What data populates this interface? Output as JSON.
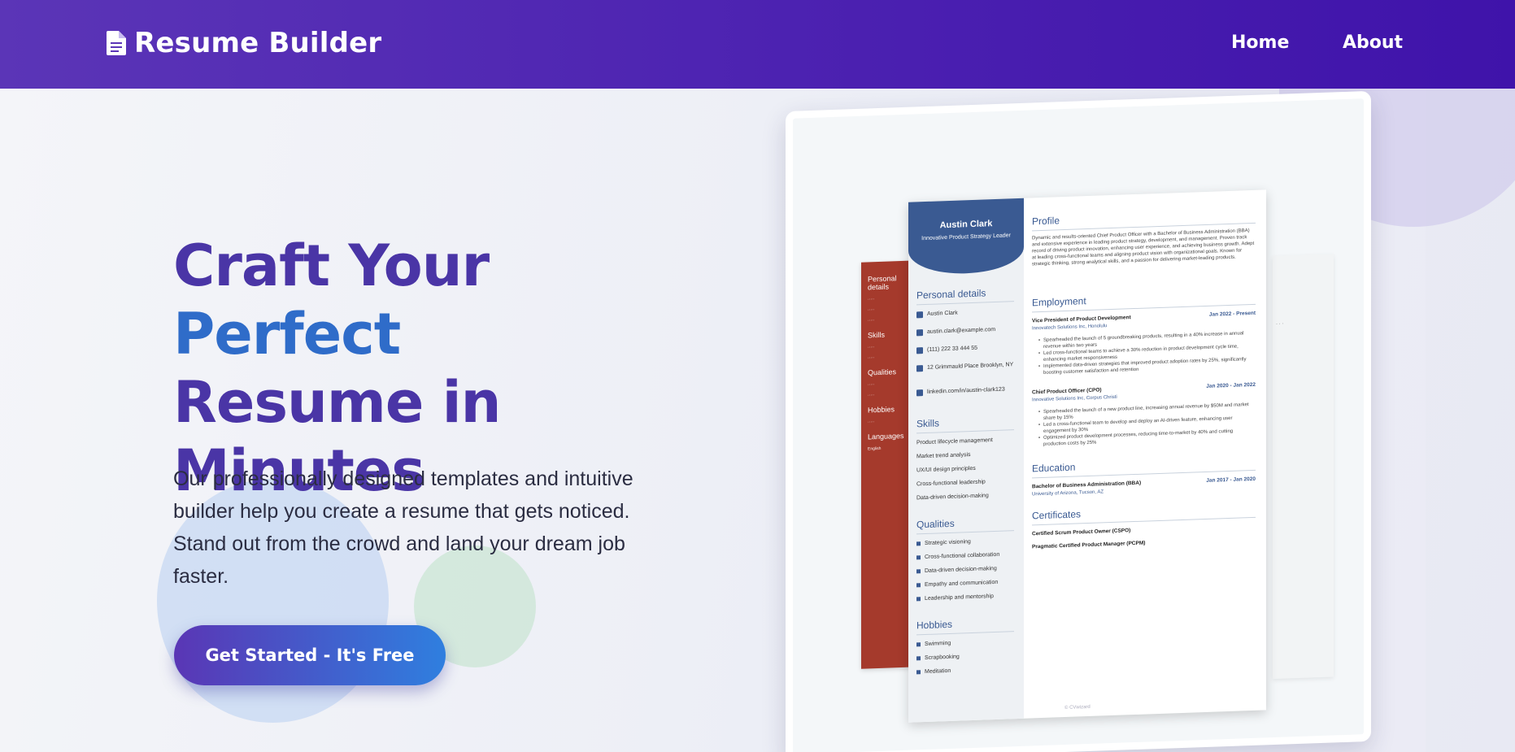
{
  "navbar": {
    "brand": "Resume Builder",
    "links": {
      "home": "Home",
      "about": "About"
    }
  },
  "hero": {
    "headline_dark_1": "Craft Your ",
    "headline_blue": "Perfect",
    "headline_dark_2": "Resume in",
    "headline_dark_3": "Minutes",
    "subtext": "Our professionally designed templates and intuitive builder help you create a resume that gets noticed. Stand out from the crowd and land your dream job faster.",
    "cta": "Get Started - It's Free"
  },
  "resume_preview": {
    "name": "Austin Clark",
    "tagline": "Innovative Product Strategy Leader",
    "personal_title": "Personal details",
    "personal": [
      "Austin Clark",
      "austin.clark@example.com",
      "(111) 222 33 444 55",
      "12 Grimmauld Place Brooklyn, NY",
      "linkedin.com/in/austin-clark123"
    ],
    "skills_title": "Skills",
    "skills": [
      "Product lifecycle management",
      "Market trend analysis",
      "UX/UI design principles",
      "Cross-functional leadership",
      "Data-driven decision-making"
    ],
    "qualities_title": "Qualities",
    "qualities": [
      "Strategic visioning",
      "Cross-functional collaboration",
      "Data-driven decision-making",
      "Empathy and communication",
      "Leadership and mentorship"
    ],
    "hobbies_title": "Hobbies",
    "hobbies": [
      "Swimming",
      "Scrapbooking",
      "Meditation"
    ],
    "profile_title": "Profile",
    "profile_text": "Dynamic and results-oriented Chief Product Officer with a Bachelor of Business Administration (BBA) and extensive experience in leading product strategy, development, and management. Proven track record of driving product innovation, enhancing user experience, and achieving business growth. Adept at leading cross-functional teams and aligning product vision with organizational goals. Known for strategic thinking, strong analytical skills, and a passion for delivering market-leading products.",
    "employment_title": "Employment",
    "jobs": [
      {
        "title": "Vice President of Product Development",
        "date": "Jan 2022 - Present",
        "company": "Innovatech Solutions Inc, Honolulu",
        "bullets": [
          "Spearheaded the launch of 5 groundbreaking products, resulting in a 40% increase in annual revenue within two years",
          "Led cross-functional teams to achieve a 30% reduction in product development cycle time, enhancing market responsiveness",
          "Implemented data-driven strategies that improved product adoption rates by 25%, significantly boosting customer satisfaction and retention"
        ]
      },
      {
        "title": "Chief Product Officer (CPO)",
        "date": "Jan 2020 - Jan 2022",
        "company": "Innovative Solutions Inc, Corpus Christi",
        "bullets": [
          "Spearheaded the launch of a new product line, increasing annual revenue by $50M and market share by 15%",
          "Led a cross-functional team to develop and deploy an AI-driven feature, enhancing user engagement by 30%",
          "Optimized product development processes, reducing time-to-market by 40% and cutting production costs by 25%"
        ]
      }
    ],
    "education_title": "Education",
    "education": {
      "degree": "Bachelor of Business Administration (BBA)",
      "date": "Jan 2017 - Jan 2020",
      "school": "University of Arizona, Tucson, AZ"
    },
    "certificates_title": "Certificates",
    "certificates": [
      "Certified Scrum Product Owner (CSPO)",
      "Pragmatic Certified Product Manager (PCPM)"
    ],
    "watermark": "© CVwizard",
    "back_doc": {
      "personal_title": "Personal details",
      "skills_title": "Skills",
      "qualities_title": "Qualities",
      "hobbies_title": "Hobbies",
      "languages_title": "Languages",
      "language": "English"
    }
  },
  "colors": {
    "nav_start": "#5b35b7",
    "nav_end": "#3f13aa",
    "headline_dark": "#4a35a6",
    "headline_blue": "#2f6cc9",
    "resume_accent": "#3a5a92",
    "resume_red": "#a53a2c"
  },
  "icons": {
    "brand": "document-icon"
  }
}
